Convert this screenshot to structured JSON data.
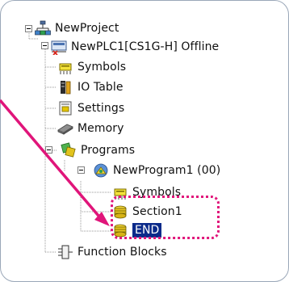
{
  "tree": {
    "nodes": [
      {
        "label": "NewProject",
        "icon": "project-network-icon"
      },
      {
        "label": "NewPLC1[CS1G-H] Offline",
        "icon": "plc-offline-icon"
      },
      {
        "label": "Symbols",
        "icon": "symbols-icon"
      },
      {
        "label": "IO Table",
        "icon": "io-table-icon"
      },
      {
        "label": "Settings",
        "icon": "settings-icon"
      },
      {
        "label": "Memory",
        "icon": "memory-icon"
      },
      {
        "label": "Programs",
        "icon": "programs-icon"
      },
      {
        "label": "NewProgram1 (00)",
        "icon": "program-icon"
      },
      {
        "label": "Symbols",
        "icon": "symbols-icon"
      },
      {
        "label": "Section1",
        "icon": "section-icon"
      },
      {
        "label": "END",
        "icon": "section-icon"
      },
      {
        "label": "Function Blocks",
        "icon": "function-blocks-icon"
      }
    ]
  },
  "callout": {
    "arrow_color": "#e0157a",
    "highlight_color": "#e0157a",
    "target": "END"
  },
  "colors": {
    "selection_bg": "#0b2a8a",
    "selection_text": "#ffffff",
    "tree_line": "#9a9a9a"
  }
}
